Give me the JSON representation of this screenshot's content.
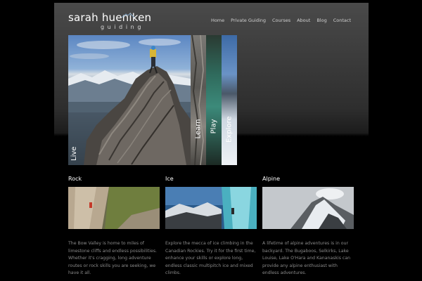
{
  "logo": {
    "name": "sarah hueniken",
    "tagline": "guiding"
  },
  "nav": {
    "items": [
      "Home",
      "Private Guiding",
      "Courses",
      "About",
      "Blog",
      "Contact"
    ]
  },
  "slider": {
    "labels": [
      "Live",
      "Learn",
      "Play",
      "Explore"
    ]
  },
  "columns": [
    {
      "title": "Rock",
      "text": "The Bow Valley is home to miles of limestone cliffs and endless possibilities. Whether it's cragging, long adventure routes or rock skills you are seeking, we have it all."
    },
    {
      "title": "Ice",
      "text": "Explore the mecca of ice climbing in the Canadian Rockies. Try it for the first time, enhance your skills or explore long, endless classic multipitch ice and mixed climbs."
    },
    {
      "title": "Alpine",
      "text": "A lifetime of alpine adventures is in our backyard. The Bugaboos, Selkirks, Lake Louise, Lake O'Hara and Kananaskis can provide any alpine enthusiast with endless adventures."
    }
  ],
  "colors": {
    "background": "#000000",
    "header_gray": "#4a4a4a",
    "nav_text": "#d0d0d0",
    "body_text": "#8a8a8a"
  }
}
